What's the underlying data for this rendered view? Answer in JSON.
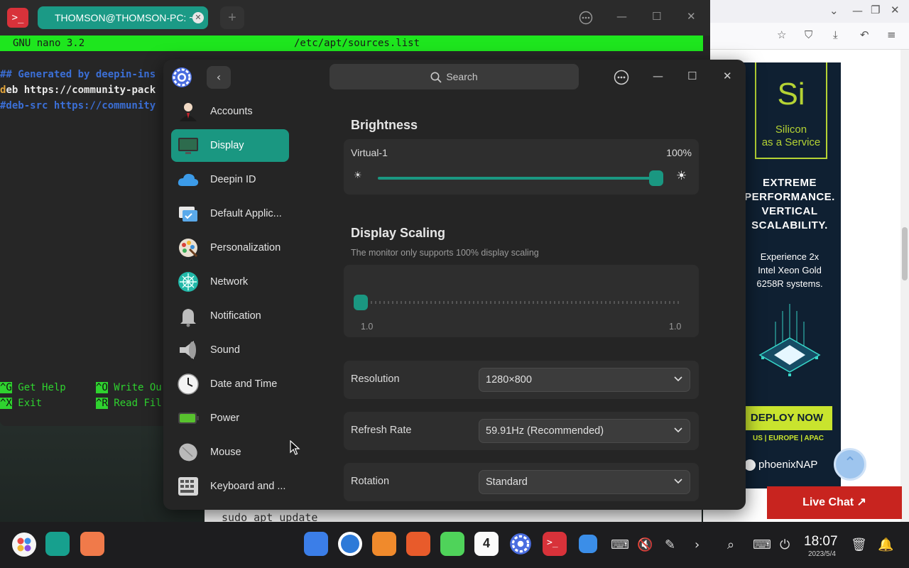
{
  "terminal": {
    "tab_title": "THOMSON@THOMSON-PC: ~",
    "nano_version": "GNU nano 3.2",
    "file_path": "/etc/apt/sources.list",
    "lines": [
      "## Generated by deepin-ins",
      "deb https://community-pack",
      "#deb-src https://community"
    ],
    "help": [
      {
        "key": "^G",
        "label": "Get Help"
      },
      {
        "key": "^O",
        "label": "Write Ou"
      },
      {
        "key": "^X",
        "label": "Exit"
      },
      {
        "key": "^R",
        "label": "Read Fil"
      }
    ],
    "behind_text": "sudo apt update"
  },
  "browser": {
    "ad": {
      "si": "Si",
      "si_sub": "Silicon\nas a Service",
      "headline": "EXTREME\nPERFORMANCE.\nVERTICAL\nSCALABILITY.",
      "body": "Experience 2x\nIntel Xeon Gold\n6258R systems.",
      "button": "DEPLOY NOW",
      "regions": "US | EUROPE | APAC",
      "brand": "phoenixNAP"
    },
    "live_chat": "Live Chat ↗"
  },
  "settings": {
    "search_placeholder": "Search",
    "sidebar": [
      {
        "label": "Accounts",
        "icon": "accounts-icon"
      },
      {
        "label": "Display",
        "icon": "display-icon",
        "active": true
      },
      {
        "label": "Deepin ID",
        "icon": "cloud-icon"
      },
      {
        "label": "Default Applic...",
        "icon": "default-apps-icon"
      },
      {
        "label": "Personalization",
        "icon": "palette-icon"
      },
      {
        "label": "Network",
        "icon": "network-icon"
      },
      {
        "label": "Notification",
        "icon": "bell-icon"
      },
      {
        "label": "Sound",
        "icon": "speaker-icon"
      },
      {
        "label": "Date and Time",
        "icon": "clock-icon"
      },
      {
        "label": "Power",
        "icon": "battery-icon"
      },
      {
        "label": "Mouse",
        "icon": "mouse-icon"
      },
      {
        "label": "Keyboard and ...",
        "icon": "keyboard-icon"
      }
    ],
    "brightness": {
      "title": "Brightness",
      "monitor": "Virtual-1",
      "value_label": "100%",
      "level": 1.0
    },
    "scaling": {
      "title": "Display Scaling",
      "note": "The monitor only supports 100% display scaling",
      "min_label": "1.0",
      "max_label": "1.0"
    },
    "resolution": {
      "label": "Resolution",
      "value": "1280×800"
    },
    "refresh_rate": {
      "label": "Refresh Rate",
      "value": "59.91Hz (Recommended)"
    },
    "rotation": {
      "label": "Rotation",
      "value": "Standard"
    }
  },
  "taskbar": {
    "time": "18:07",
    "date": "2023/5/4",
    "calendar_day": "4"
  },
  "colors": {
    "accent": "#1a9781",
    "nano_green": "#1ee61e",
    "live_chat_red": "#c8241f",
    "ad_lime": "#c9e42e"
  }
}
